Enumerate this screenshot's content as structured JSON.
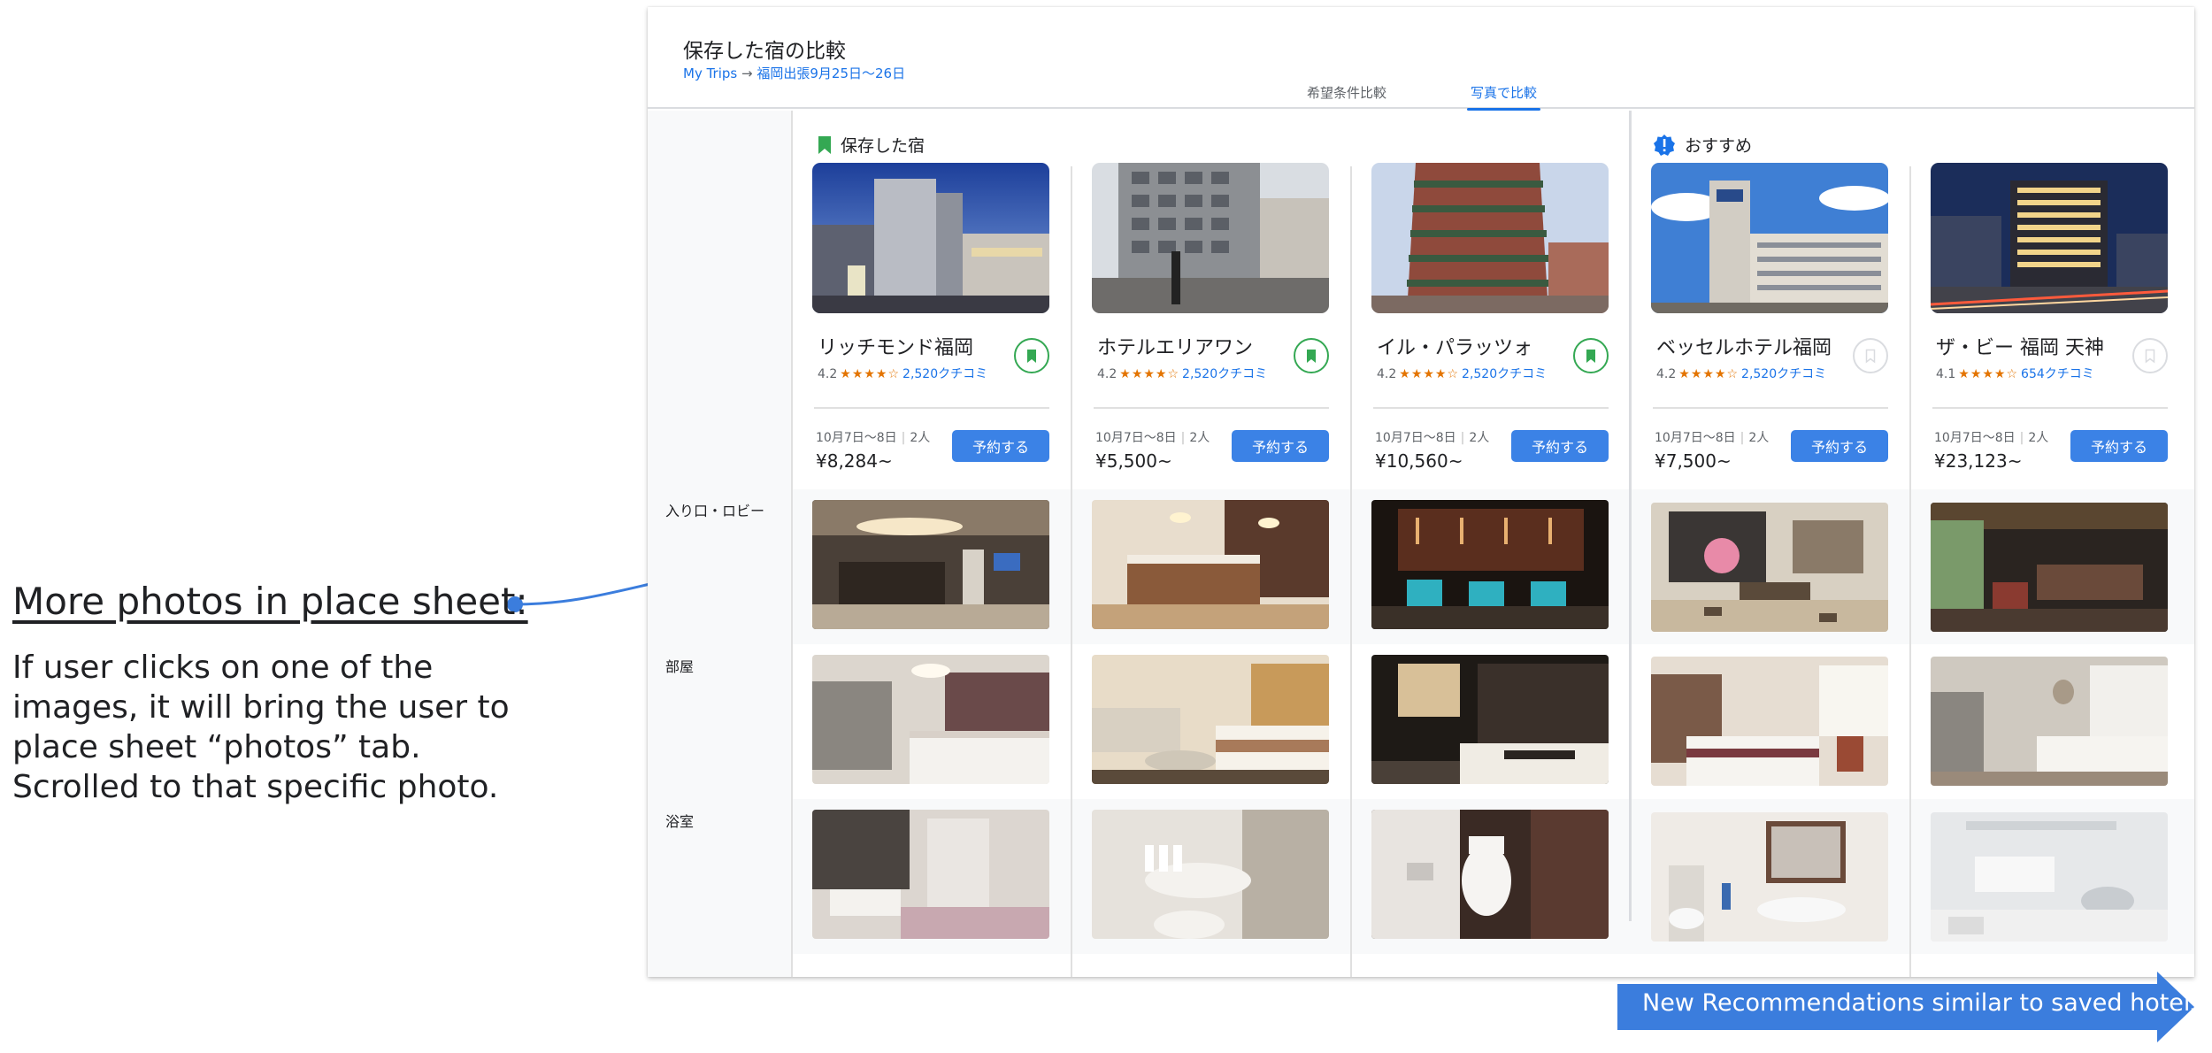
{
  "annotation": {
    "title": "More photos in place sheet:",
    "body": "If user clicks on one of the images, it will bring the user to place sheet “photos” tab. Scrolled to that specific photo."
  },
  "header": {
    "title": "保存した宿の比較",
    "breadcrumb": {
      "root": "My Trips",
      "separator": "→",
      "trip": "福岡出張9月25日〜26日"
    },
    "tabs": [
      {
        "label": "希望条件比較",
        "active": false
      },
      {
        "label": "写真で比較",
        "active": true
      }
    ]
  },
  "groups": {
    "saved": "保存した宿",
    "recommended": "おすすめ"
  },
  "row_labels": [
    "入り口・ロビー",
    "部屋",
    "浴室"
  ],
  "hotels": [
    {
      "name": "リッチモンド福岡",
      "rating": "4.2",
      "stars": "★★★★☆",
      "reviews": "2,520クチコミ",
      "saved": true,
      "dates": "10月7日〜8日",
      "guests": "2人",
      "price": "¥8,284~",
      "book": "予約する"
    },
    {
      "name": "ホテルエリアワン",
      "rating": "4.2",
      "stars": "★★★★☆",
      "reviews": "2,520クチコミ",
      "saved": true,
      "dates": "10月7日〜8日",
      "guests": "2人",
      "price": "¥5,500~",
      "book": "予約する"
    },
    {
      "name": "イル・パラッツォ",
      "rating": "4.2",
      "stars": "★★★★☆",
      "reviews": "2,520クチコミ",
      "saved": true,
      "dates": "10月7日〜8日",
      "guests": "2人",
      "price": "¥10,560~",
      "book": "予約する"
    },
    {
      "name": "ベッセルホテル福岡",
      "rating": "4.2",
      "stars": "★★★★☆",
      "reviews": "2,520クチコミ",
      "saved": false,
      "dates": "10月7日〜8日",
      "guests": "2人",
      "price": "¥7,500~",
      "book": "予約する"
    },
    {
      "name": "ザ・ビー 福岡 天神",
      "rating": "4.1",
      "stars": "★★★★☆",
      "reviews": "654クチコミ",
      "saved": false,
      "dates": "10月7日〜8日",
      "guests": "2人",
      "price": "¥23,123~",
      "book": "予約する"
    }
  ],
  "banner": "New Recommendations similar to saved hotels",
  "colors": {
    "accent": "#1a73e8",
    "button": "#3b82e6",
    "saved_green": "#34a853",
    "stars": "#e37400",
    "banner": "#3b7ddd"
  }
}
